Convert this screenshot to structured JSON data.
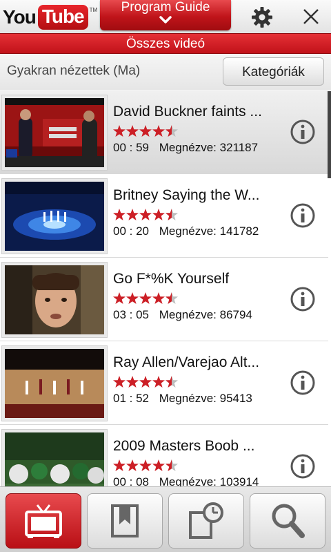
{
  "header": {
    "logo_you": "You",
    "logo_tube": "Tube",
    "logo_tm": "TM",
    "guide_label": "Program Guide",
    "icons": [
      "gear-icon",
      "close-icon",
      "chevron-down-icon"
    ]
  },
  "banner": {
    "label": "Összes videó"
  },
  "subheader": {
    "label": "Gyakran nézettek (Ma)",
    "category_button": "Kategóriák"
  },
  "videos": [
    {
      "title": "David Buckner faints ...",
      "duration": "00 : 59",
      "views": "Megnézve: 321187",
      "rating": 4.5,
      "selected": true
    },
    {
      "title": "Britney Saying the W...",
      "duration": "00 : 20",
      "views": "Megnézve: 141782",
      "rating": 4.5,
      "selected": false
    },
    {
      "title": "Go F*%K Yourself",
      "duration": "03 : 05",
      "views": "Megnézve: 86794",
      "rating": 4.5,
      "selected": false
    },
    {
      "title": "Ray Allen/Varejao Alt...",
      "duration": "01 : 52",
      "views": "Megnézve: 95413",
      "rating": 4.5,
      "selected": false
    },
    {
      "title": "2009 Masters Boob ...",
      "duration": "00 : 08",
      "views": "Megnézve: 103914",
      "rating": 4.5,
      "selected": false
    }
  ],
  "bottom_nav": {
    "items": [
      "tv-icon",
      "bookmark-icon",
      "history-icon",
      "search-icon"
    ],
    "active_index": 0
  },
  "colors": {
    "accent": "#c1121a",
    "star": "#cc1f26"
  }
}
